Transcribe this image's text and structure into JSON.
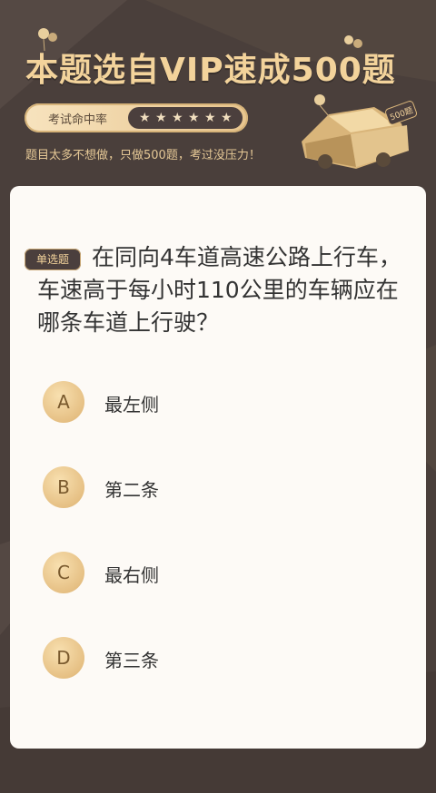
{
  "header": {
    "title": "本题选自VIP速成500题",
    "rate_label": "考试命中率",
    "stars": [
      "★",
      "★",
      "★",
      "★",
      "★",
      "★"
    ],
    "tagline": "题目太多不想做，只做500题，考过没压力！",
    "car_badge": "500题"
  },
  "question": {
    "type_badge": "单选题",
    "text": "在同向4车道高速公路上行车，车速高于每小时110公里的车辆应在哪条车道上行驶？",
    "options": [
      {
        "letter": "A",
        "text": "最左侧"
      },
      {
        "letter": "B",
        "text": "第二条"
      },
      {
        "letter": "C",
        "text": "最右侧"
      },
      {
        "letter": "D",
        "text": "第三条"
      }
    ]
  },
  "colors": {
    "background": "#4a3f3b",
    "accent_gold": "#f3d39b",
    "card": "#fdfaf6"
  }
}
